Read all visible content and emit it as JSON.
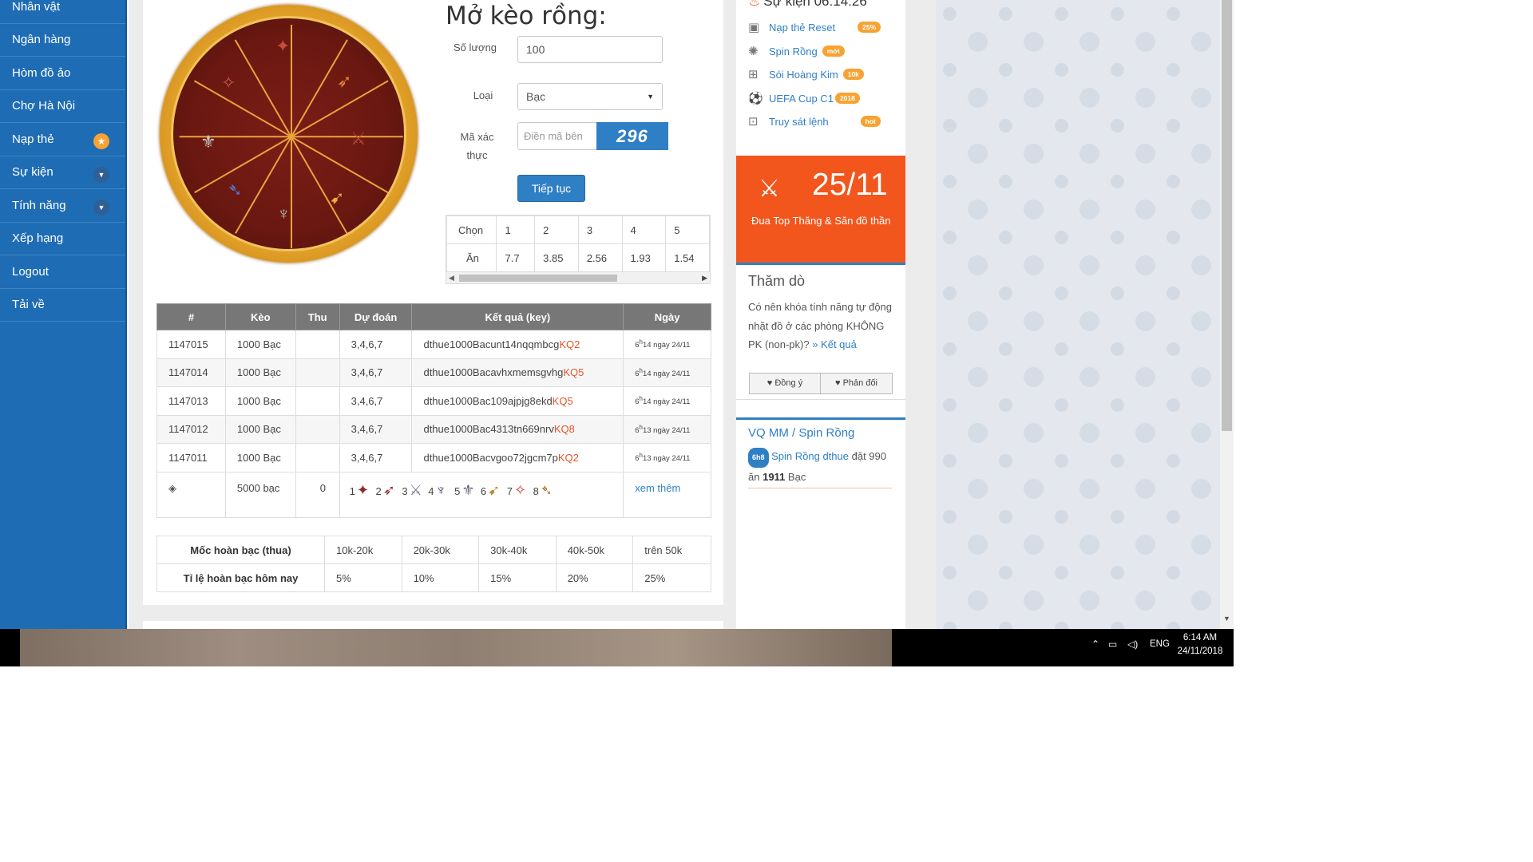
{
  "sidebar": {
    "items": [
      {
        "label": "Nhân vật"
      },
      {
        "label": "Ngân hàng"
      },
      {
        "label": "Hòm đồ ảo"
      },
      {
        "label": "Chợ Hà Nội"
      },
      {
        "label": "Nạp thẻ"
      },
      {
        "label": "Sự kiện"
      },
      {
        "label": "Tính năng"
      },
      {
        "label": "Xếp hạng"
      },
      {
        "label": "Logout"
      },
      {
        "label": "Tải về"
      }
    ]
  },
  "form": {
    "title": "Mở kèo rồng:",
    "quantity_label": "Số lượng",
    "quantity_value": "100",
    "type_label": "Loại",
    "type_value": "Bạc",
    "captcha_label_1": "Mã xác",
    "captcha_label_2": "thực",
    "captcha_placeholder": "Điền mã bên",
    "captcha_code": "296",
    "continue_label": "Tiếp tục"
  },
  "odds": {
    "choose_label": "Chọn",
    "win_label": "Ăn",
    "choices": [
      "1",
      "2",
      "3",
      "4",
      "5"
    ],
    "payouts": [
      "7.7",
      "3.85",
      "2.56",
      "1.93",
      "1.54"
    ]
  },
  "history": {
    "headers": [
      "#",
      "Kèo",
      "Thu",
      "Dự đoán",
      "Kết quả (key)",
      "Ngày"
    ],
    "rows": [
      {
        "id": "1147015",
        "bet": "1000 Bạc",
        "thu": "",
        "guess": "3,4,6,7",
        "key": "dthue1000Bacunt14nqqmbcg",
        "kq": "KQ2",
        "date_h": "6",
        "date_sup": "h",
        "date_rest": "14 ngày 24/11"
      },
      {
        "id": "1147014",
        "bet": "1000 Bạc",
        "thu": "",
        "guess": "3,4,6,7",
        "key": "dthue1000Bacavhxmemsgvhg",
        "kq": "KQ5",
        "date_h": "6",
        "date_sup": "h",
        "date_rest": "14 ngày 24/11"
      },
      {
        "id": "1147013",
        "bet": "1000 Bạc",
        "thu": "",
        "guess": "3,4,6,7",
        "key": "dthue1000Bac109ajpjg8ekd",
        "kq": "KQ5",
        "date_h": "6",
        "date_sup": "h",
        "date_rest": "14 ngày 24/11"
      },
      {
        "id": "1147012",
        "bet": "1000 Bạc",
        "thu": "",
        "guess": "3,4,6,7",
        "key": "dthue1000Bac4313tn669nrv",
        "kq": "KQ8",
        "date_h": "6",
        "date_sup": "h",
        "date_rest": "13 ngày 24/11"
      },
      {
        "id": "1147011",
        "bet": "1000 Bạc",
        "thu": "",
        "guess": "3,4,6,7",
        "key": "dthue1000Bacvgoo72jgcm7p",
        "kq": "KQ2",
        "date_h": "6",
        "date_sup": "h",
        "date_rest": "13 ngày 24/11"
      }
    ],
    "summary": {
      "bet": "5000 bạc",
      "thu": "0",
      "numbers": [
        "1",
        "2",
        "3",
        "4",
        "5",
        "6",
        "7",
        "8"
      ],
      "more": "xem thêm"
    }
  },
  "refund": {
    "row1_label": "Mốc hoàn bạc (thua)",
    "row2_label": "Tỉ lệ hoàn bạc hôm nay",
    "tiers": [
      "10k-20k",
      "20k-30k",
      "30k-40k",
      "40k-50k",
      "trên 50k"
    ],
    "rates": [
      "5%",
      "10%",
      "15%",
      "20%",
      "25%"
    ]
  },
  "events": {
    "header": "Sự kiện 06:14:26",
    "items": [
      {
        "label": "Nạp thẻ Reset",
        "pill": "25%",
        "icon": "card-icon"
      },
      {
        "label": "Spin Rồng",
        "pill": "mới",
        "icon": "spinner-icon"
      },
      {
        "label": "Sói Hoàng Kim",
        "pill": "10k",
        "icon": "gift-icon"
      },
      {
        "label": "UEFA Cup C1",
        "pill": "2018",
        "icon": "soccer-ball-icon"
      },
      {
        "label": "Truy sát lệnh",
        "pill": "hot",
        "icon": "robot-icon"
      }
    ]
  },
  "promo": {
    "date": "25/11",
    "text": "Đua Top Thăng & Săn đồ thần"
  },
  "poll": {
    "title": "Thăm dò",
    "question": "Có nên khóa tính năng tự động nhặt đồ ở các phòng KHÔNG PK (non-pk)?",
    "result_link": "» Kết quả",
    "agree": "Đồng ý",
    "disagree": "Phản đối"
  },
  "spin": {
    "title": "VQ MM / Spin Rồng",
    "badge": "6h8",
    "entry_link": "Spin Rồng dthue",
    "entry_text_1": "đặt 990 ăn",
    "entry_amount": "1911",
    "entry_text_2": "Bạc"
  },
  "taskbar": {
    "lang": "ENG",
    "time": "6:14 AM",
    "date": "24/11/2018"
  },
  "colors": {
    "sidebar": "#1e6cb4",
    "accent": "#2f7fc5",
    "promo": "#f2561d",
    "pill": "#f7a233",
    "key_result": "#e8532b"
  }
}
